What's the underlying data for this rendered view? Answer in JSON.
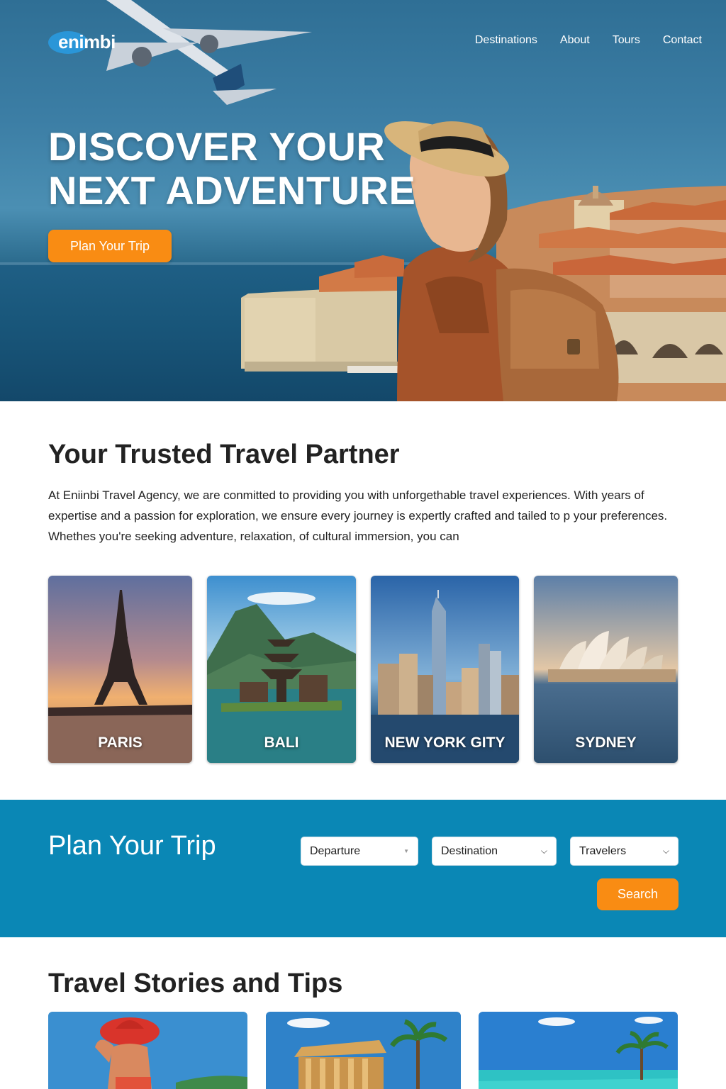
{
  "brand": {
    "logo_text": "enimbi"
  },
  "nav": {
    "items": [
      "Destinations",
      "About",
      "Tours",
      "Contact"
    ]
  },
  "hero": {
    "title_line1": "DISCOVER YOUR",
    "title_line2": "NEXT ADVENTURE",
    "cta_label": "Plan Your Trip"
  },
  "about": {
    "title": "Your Trusted Travel Partner",
    "text": "At Eniinbi Travel Agency, we are conmitted to providing you with unforgethable travel experiences. With years of expertise and a passion for exploration, we ensure every journey is expertly crafted and tailed to p your preferences. Whethes you're seeking adventure, relaxation, of cultural immersion, you can"
  },
  "destinations": [
    {
      "name": "PARIS"
    },
    {
      "name": "BALI"
    },
    {
      "name": "NEW YORK GITY"
    },
    {
      "name": "SYDNEY"
    }
  ],
  "plan": {
    "title": "Plan Your Trip",
    "departure_label": "Departure",
    "destination_label": "Destination",
    "travelers_label": "Travelers",
    "search_label": "Search"
  },
  "stories": {
    "title": "Travel Stories and Tips"
  },
  "colors": {
    "accent_orange": "#f98c13",
    "plan_band_blue": "#0a87b5",
    "logo_blue": "#2a96d8"
  }
}
